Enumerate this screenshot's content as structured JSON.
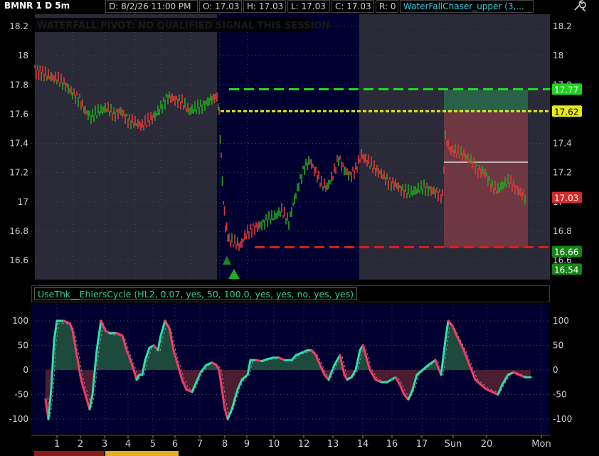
{
  "header": {
    "symbol": "BMNR 1 D 5m",
    "date": "D: 8/2/26 11:00 PM",
    "open": "O: 17.03",
    "high": "H: 17.03",
    "low": "L: 17.03",
    "close": "C: 17.03",
    "range": "R: 0",
    "study": "WaterFallChaser_upper (3,...",
    "settings_icon": "wrench-icon"
  },
  "price_panel": {
    "status_text": "WATERFALL PIVOT: NO QUALIFIED SIGNAL THIS SESSION",
    "y_axis_labels": [
      "18.2",
      "18",
      "17.8",
      "17.6",
      "17.4",
      "17.2",
      "17",
      "16.8",
      "16.6"
    ],
    "price_tags": [
      {
        "value": "17.77",
        "color": "#1bd61b"
      },
      {
        "value": "17.62",
        "color": "#e8e81a"
      },
      {
        "value": "17.03",
        "color": "#d42a2a"
      },
      {
        "value": "16.66",
        "color": "#148414"
      },
      {
        "value": "16.54",
        "color": "#148414"
      }
    ],
    "level_lines": {
      "upper": {
        "value": 17.77,
        "color": "#22dd22"
      },
      "pivot": {
        "value": 17.62,
        "color": "#e6e61a"
      },
      "lower": {
        "value": 16.69,
        "color": "#d81e1e"
      }
    }
  },
  "oscillator_panel": {
    "title": "UseThk__EhlersCycle (HL2, 0.07, yes, 50, 100.0, yes, yes, no, yes, yes)",
    "y_axis_labels": [
      "100",
      "50",
      "0",
      "-50",
      "-100"
    ]
  },
  "x_axis": {
    "labels": [
      "1",
      "2",
      "3",
      "4",
      "5",
      "6",
      "7",
      "8",
      "9",
      "10",
      "12",
      "13",
      "14",
      "16",
      "17",
      "Sun",
      "20",
      "Mon"
    ]
  }
}
